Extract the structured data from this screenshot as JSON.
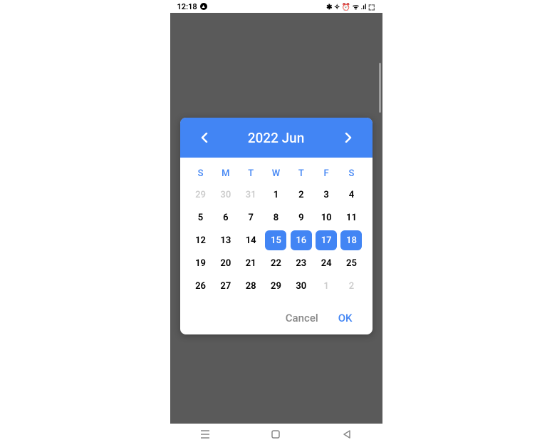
{
  "status": {
    "time": "12:18",
    "icons": "✱ ✧ ⏰ ᯤ .ıl ⬚"
  },
  "picker": {
    "title": "2022 Jun",
    "weekdays": [
      "S",
      "M",
      "T",
      "W",
      "T",
      "F",
      "S"
    ],
    "weeks": [
      [
        {
          "d": "29",
          "other": true,
          "sel": false
        },
        {
          "d": "30",
          "other": true,
          "sel": false
        },
        {
          "d": "31",
          "other": true,
          "sel": false
        },
        {
          "d": "1",
          "other": false,
          "sel": false
        },
        {
          "d": "2",
          "other": false,
          "sel": false
        },
        {
          "d": "3",
          "other": false,
          "sel": false
        },
        {
          "d": "4",
          "other": false,
          "sel": false
        }
      ],
      [
        {
          "d": "5",
          "other": false,
          "sel": false
        },
        {
          "d": "6",
          "other": false,
          "sel": false
        },
        {
          "d": "7",
          "other": false,
          "sel": false
        },
        {
          "d": "8",
          "other": false,
          "sel": false
        },
        {
          "d": "9",
          "other": false,
          "sel": false
        },
        {
          "d": "10",
          "other": false,
          "sel": false
        },
        {
          "d": "11",
          "other": false,
          "sel": false
        }
      ],
      [
        {
          "d": "12",
          "other": false,
          "sel": false
        },
        {
          "d": "13",
          "other": false,
          "sel": false
        },
        {
          "d": "14",
          "other": false,
          "sel": false
        },
        {
          "d": "15",
          "other": false,
          "sel": true
        },
        {
          "d": "16",
          "other": false,
          "sel": true
        },
        {
          "d": "17",
          "other": false,
          "sel": true
        },
        {
          "d": "18",
          "other": false,
          "sel": true
        }
      ],
      [
        {
          "d": "19",
          "other": false,
          "sel": false
        },
        {
          "d": "20",
          "other": false,
          "sel": false
        },
        {
          "d": "21",
          "other": false,
          "sel": false
        },
        {
          "d": "22",
          "other": false,
          "sel": false
        },
        {
          "d": "23",
          "other": false,
          "sel": false
        },
        {
          "d": "24",
          "other": false,
          "sel": false
        },
        {
          "d": "25",
          "other": false,
          "sel": false
        }
      ],
      [
        {
          "d": "26",
          "other": false,
          "sel": false
        },
        {
          "d": "27",
          "other": false,
          "sel": false
        },
        {
          "d": "28",
          "other": false,
          "sel": false
        },
        {
          "d": "29",
          "other": false,
          "sel": false
        },
        {
          "d": "30",
          "other": false,
          "sel": false
        },
        {
          "d": "1",
          "other": true,
          "sel": false
        },
        {
          "d": "2",
          "other": true,
          "sel": false
        }
      ]
    ],
    "actions": {
      "cancel": "Cancel",
      "ok": "OK"
    }
  }
}
